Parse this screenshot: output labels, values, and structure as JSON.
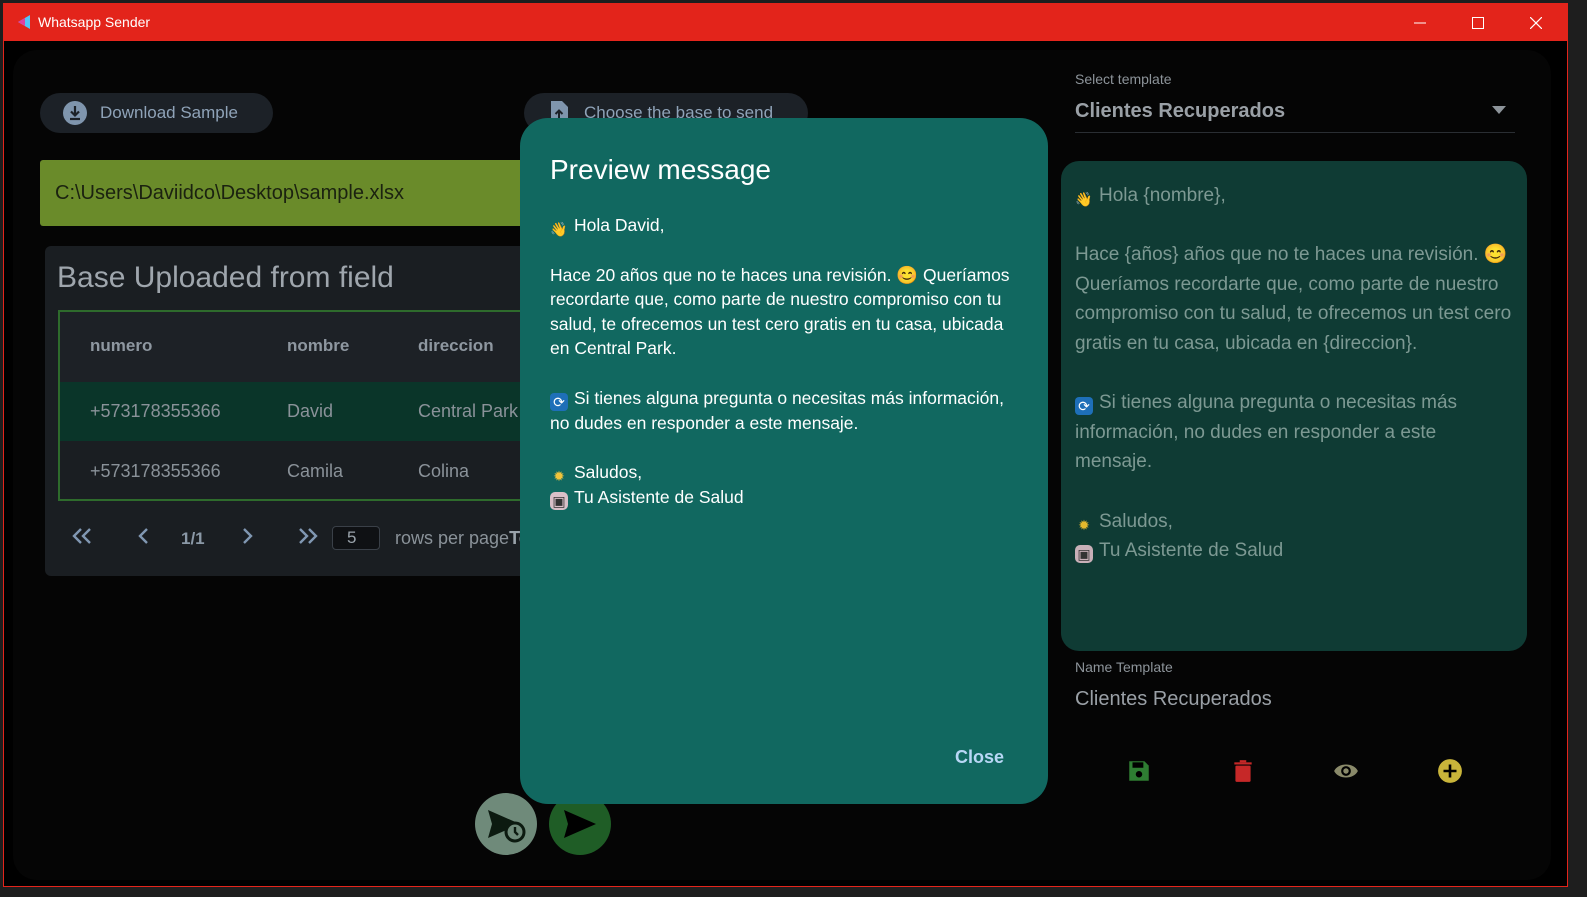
{
  "window": {
    "title": "Whatsapp Sender"
  },
  "toolbar": {
    "download_sample": "Download Sample",
    "choose_base": "Choose the base to send"
  },
  "file": {
    "path": "C:\\Users\\Daviidco\\Desktop\\sample.xlsx"
  },
  "table": {
    "title": "Base Uploaded from field",
    "columns": [
      "numero",
      "nombre",
      "direccion"
    ],
    "rows": [
      [
        "+573178355366",
        "David",
        "Central Park"
      ],
      [
        "+573178355366",
        "Camila",
        "Colina"
      ]
    ],
    "pagination": {
      "page": "1/1",
      "rows_per_page": "5",
      "rows_label": "rows per page",
      "total_fragment": "To"
    }
  },
  "template": {
    "select_label": "Select template",
    "selected": "Clientes Recuperados",
    "lines": [
      "Hola {nombre},",
      "",
      "Hace {años} años que no te haces una revisión. 😊 Queríamos recordarte que, como parte de nuestro compromiso con tu salud, te ofrecemos un test cero gratis en tu casa, ubicada en {direccion}.",
      "",
      "Si tienes alguna pregunta o necesitas más información, no dudes en responder a este mensaje.",
      "",
      "Saludos,",
      "Tu Asistente de Salud"
    ],
    "name_label": "Name Template",
    "name_value": "Clientes Recuperados"
  },
  "modal": {
    "title": "Preview message",
    "greeting": "Hola David,",
    "paragraph1": "Hace 20 años que no te haces una revisión. 😊 Queríamos recordarte que, como parte de nuestro compromiso con tu salud, te ofrecemos un test cero gratis en tu casa, ubicada en Central Park.",
    "paragraph2": "Si tienes alguna pregunta o necesitas más información, no dudes en responder a este mensaje.",
    "sign1": "Saludos,",
    "sign2": "Tu Asistente de Salud",
    "close": "Close"
  },
  "colors": {
    "titlebar": "#e3241b",
    "modal": "#116860",
    "template_box": "#0f3b34",
    "save": "#2e7d32",
    "delete": "#c62828",
    "view": "#8a8a6a",
    "add": "#c9b53a"
  },
  "icons": [
    "app-icon",
    "minimize-icon",
    "maximize-icon",
    "close-icon",
    "download-icon",
    "file-upload-icon",
    "chevron-down-icon",
    "first-page-icon",
    "prev-page-icon",
    "next-page-icon",
    "last-page-icon",
    "save-icon",
    "delete-icon",
    "eye-icon",
    "add-circle-icon",
    "schedule-send-icon",
    "send-icon",
    "wave-emoji",
    "refresh-emoji",
    "sun-emoji",
    "robot-emoji"
  ]
}
